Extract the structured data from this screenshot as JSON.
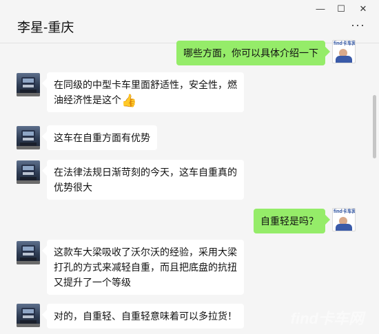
{
  "window": {
    "title": "李星-重庆",
    "minimize_glyph": "—",
    "maximize_glyph": "☐",
    "close_glyph": "✕",
    "more_glyph": "···"
  },
  "colors": {
    "outgoing_bubble": "#95ec69",
    "incoming_bubble": "#ffffff",
    "background": "#f5f5f5"
  },
  "my_avatar_text": "find卡车网",
  "messages": [
    {
      "from": "me",
      "text": "哪些方面，你可以具体介绍一下"
    },
    {
      "from": "contact",
      "text": "在同级的中型卡车里面舒适性，安全性，燃油经济性是这个",
      "emoji": "👍"
    },
    {
      "from": "contact",
      "text": "这车在自重方面有优势"
    },
    {
      "from": "contact",
      "text": "在法律法规日渐苛刻的今天，这车自重真的优势很大"
    },
    {
      "from": "me",
      "text": "自重轻是吗？"
    },
    {
      "from": "contact",
      "text": "这款车大梁吸收了沃尔沃的经验，采用大梁打孔的方式来减轻自重，而且把底盘的抗扭又提升了一个等级"
    },
    {
      "from": "contact",
      "text": "对的，自重轻、自重轻意味着可以多拉货！"
    }
  ],
  "watermark": "find卡车网"
}
